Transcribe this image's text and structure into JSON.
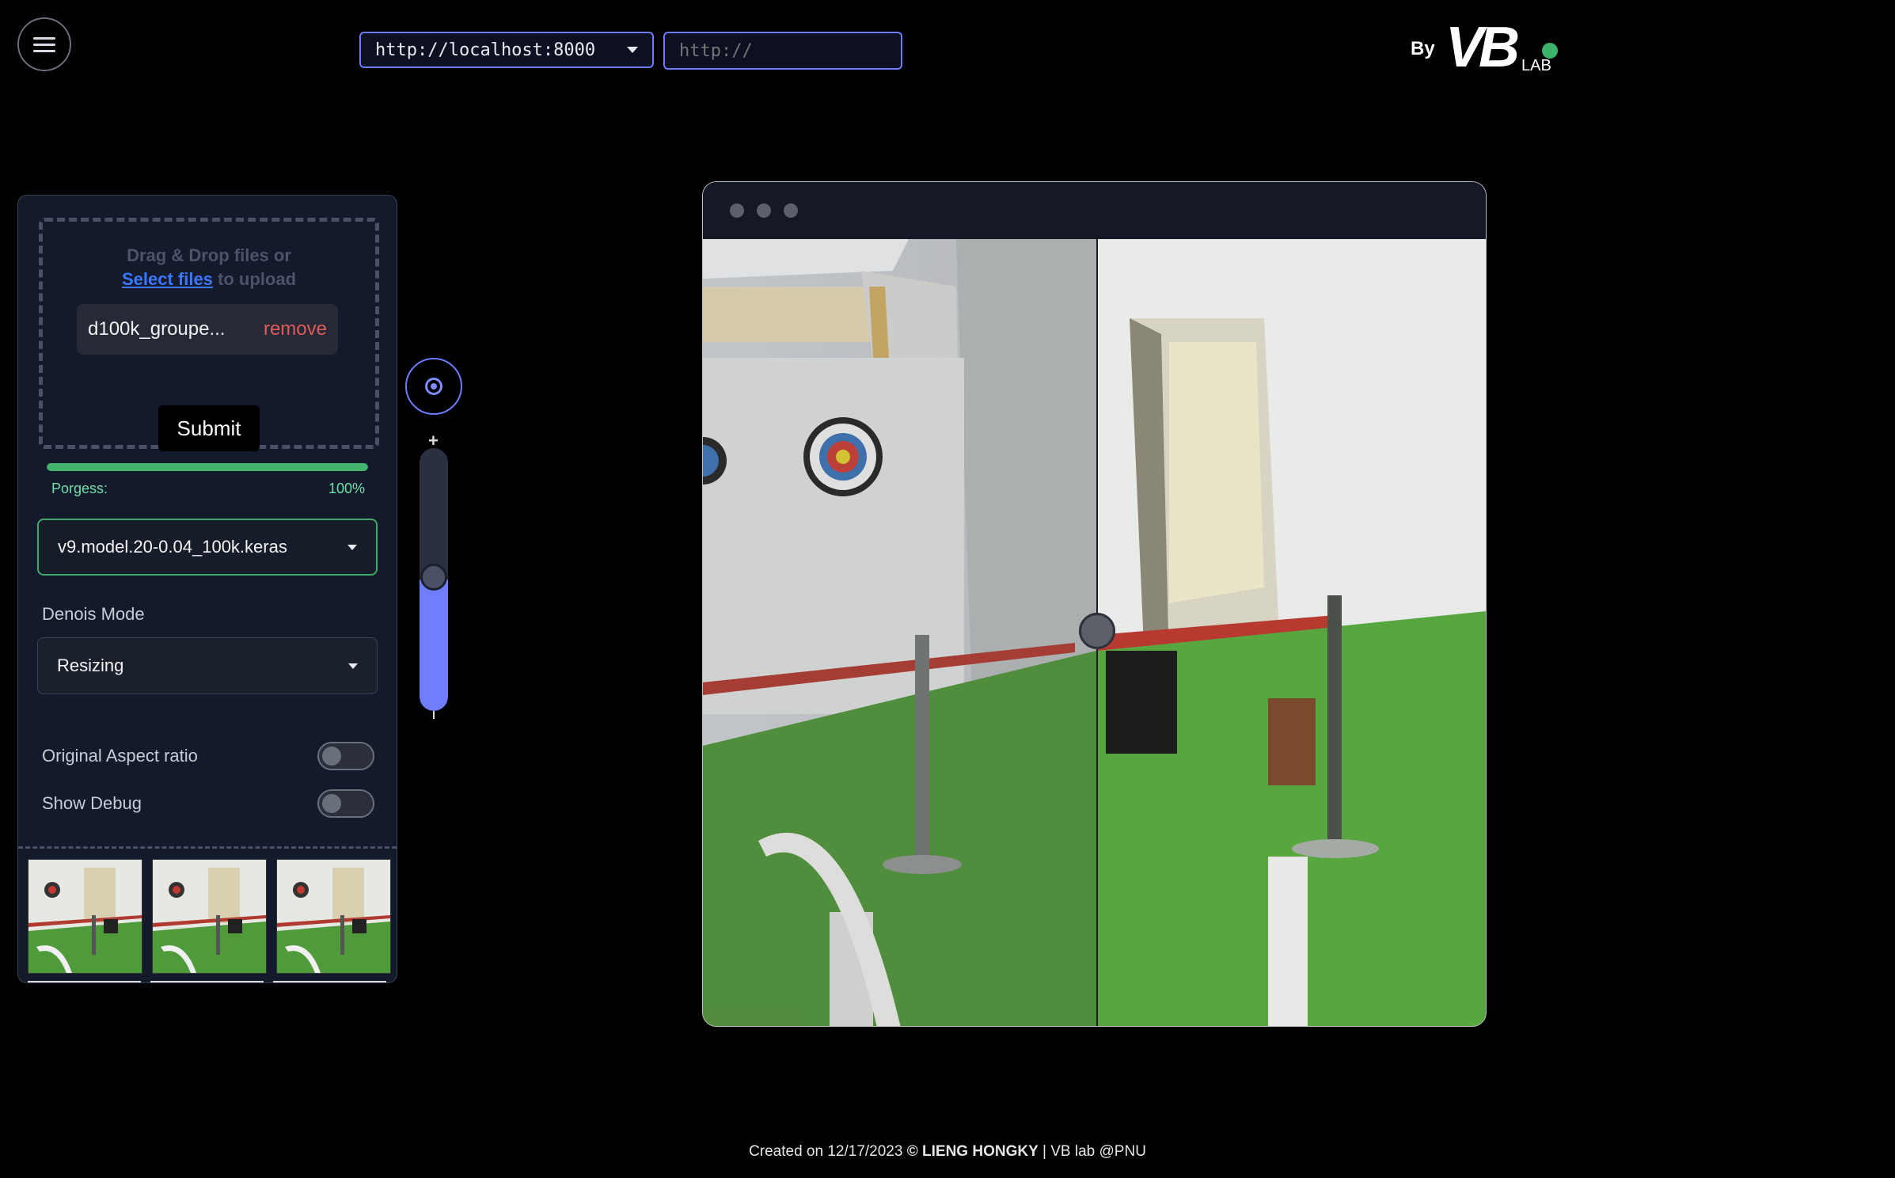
{
  "header": {
    "server_url": "http://localhost:8000",
    "custom_url_placeholder": "http://",
    "brand_by": "By",
    "brand_logo": "VB",
    "brand_lab": "LAB",
    "status_color": "#3bb36a"
  },
  "upload": {
    "prompt_line1": "Drag & Drop files or",
    "select_link": "Select files",
    "prompt_line2": "to upload",
    "file_name": "d100k_groupe...",
    "remove_label": "remove",
    "submit_label": "Submit"
  },
  "progress": {
    "label": "Porgess:",
    "value_text": "100%",
    "value": 1.0,
    "color": "#44b36e"
  },
  "settings": {
    "model": "v9.model.20-0.04_100k.keras",
    "denoise_mode_label": "Denois Mode",
    "denoise_mode": "Resizing",
    "aspect_ratio_label": "Original Aspect ratio",
    "aspect_ratio_on": false,
    "debug_label": "Show Debug",
    "debug_on": false
  },
  "zoom": {
    "plus": "+",
    "level": 0.5,
    "accent": "#6f7dff"
  },
  "thumbnails_count": 3,
  "footer": {
    "created": "Created on 12/17/2023",
    "copyright": "© LIENG HONGKY",
    "separator": "|",
    "lab": "VB lab @PNU"
  }
}
